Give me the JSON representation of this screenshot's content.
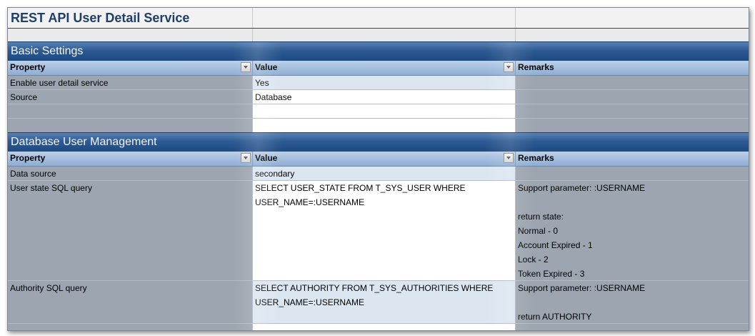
{
  "title": "REST API User Detail Service",
  "sections": [
    {
      "name": "Basic Settings",
      "headers": [
        "Property",
        "Value",
        "Remarks"
      ],
      "rows": [
        {
          "property": "Enable user detail service",
          "value": "Yes",
          "remarks": ""
        },
        {
          "property": "Source",
          "value": "Database",
          "remarks": ""
        }
      ]
    },
    {
      "name": "Database User Management",
      "headers": [
        "Property",
        "Value",
        "Remarks"
      ],
      "rows": [
        {
          "property": "Data source",
          "value": "secondary",
          "remarks": ""
        },
        {
          "property": "User state SQL query",
          "value_lines": [
            "SELECT USER_STATE FROM T_SYS_USER WHERE",
            "USER_NAME=:USERNAME"
          ],
          "remarks_lines": [
            "Support parameter: :USERNAME",
            "",
            "return state:",
            "Normal - 0",
            "Account Expired - 1",
            "Lock - 2",
            "Token Expired - 3"
          ]
        },
        {
          "property": "Authority SQL query",
          "value_lines": [
            "SELECT AUTHORITY FROM T_SYS_AUTHORITIES WHERE",
            "USER_NAME=:USERNAME"
          ],
          "remarks_lines": [
            "Support parameter: :USERNAME",
            "",
            "return AUTHORITY"
          ]
        }
      ]
    }
  ],
  "colors": {
    "title_text": "#1f3f6a",
    "section_bar": "#2d5a93",
    "header_bar": "#a6bfe0",
    "value_cell": "#dce6f1",
    "row_gray": "#9da5b0"
  },
  "icons": {
    "filter_dropdown": "chevron-down-icon"
  }
}
